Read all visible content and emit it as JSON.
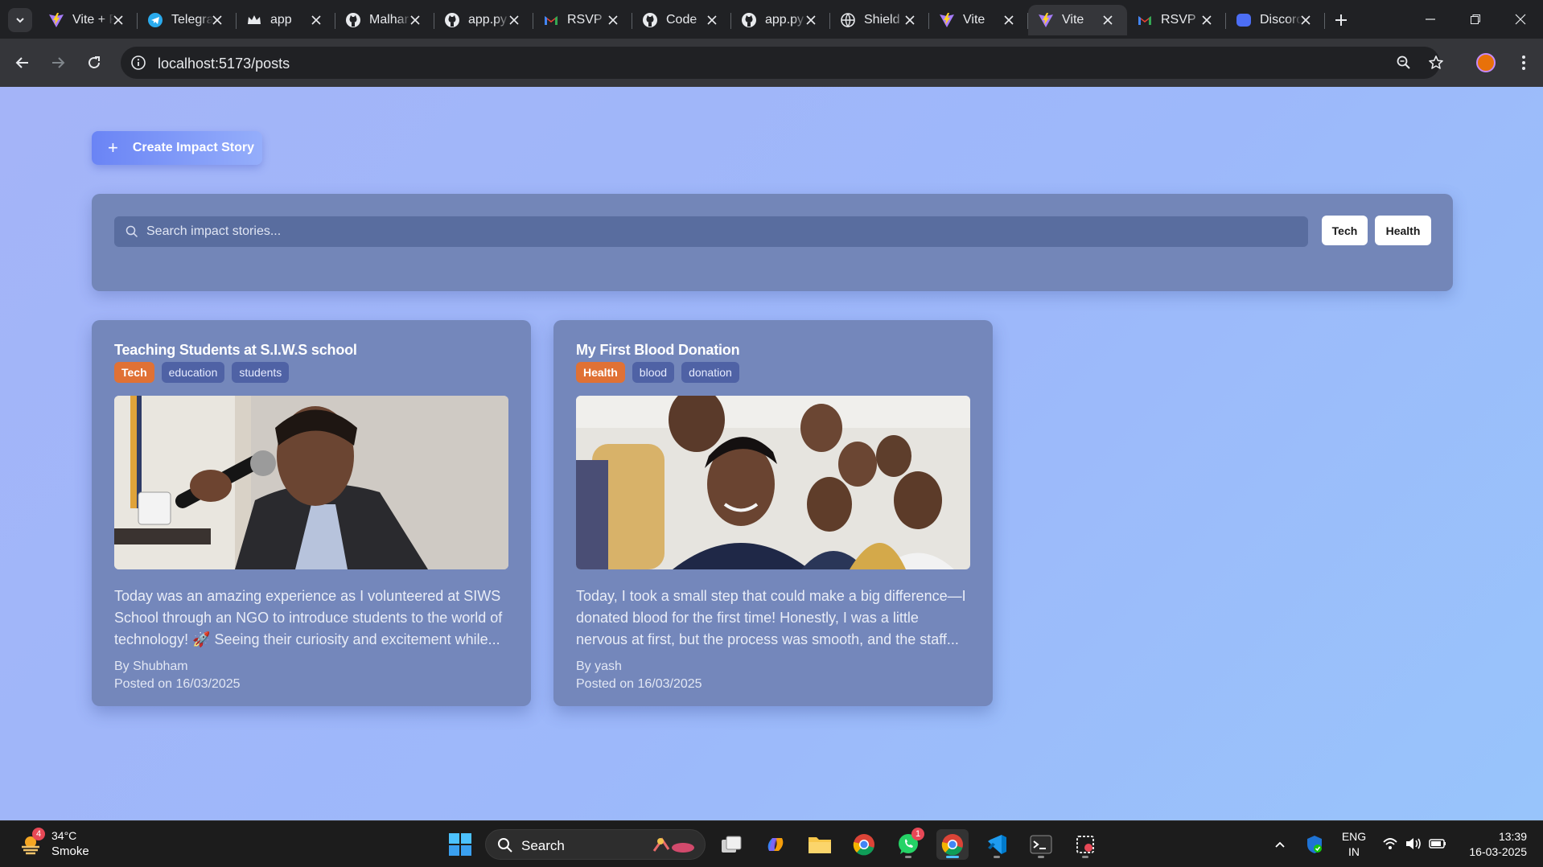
{
  "browser": {
    "tabs": [
      {
        "label": "Vite + React",
        "icon": "vite-icon"
      },
      {
        "label": "Telegram",
        "icon": "telegram-icon"
      },
      {
        "label": "app",
        "icon": "crown-icon"
      },
      {
        "label": "Malhar",
        "icon": "github-icon"
      },
      {
        "label": "app.py",
        "icon": "github-icon"
      },
      {
        "label": "RSVP",
        "icon": "gmail-icon"
      },
      {
        "label": "Code",
        "icon": "github-icon"
      },
      {
        "label": "app.py",
        "icon": "github-icon"
      },
      {
        "label": "Shield",
        "icon": "globe-icon"
      },
      {
        "label": "Vite",
        "icon": "vite-icon"
      },
      {
        "label": "Vite",
        "icon": "vite-icon",
        "active": true
      },
      {
        "label": "RSVP",
        "icon": "gmail-icon"
      },
      {
        "label": "Discord",
        "icon": "discord-icon"
      }
    ],
    "url": "localhost:5173/posts"
  },
  "page": {
    "create_button": "Create Impact Story",
    "search_placeholder": "Search impact stories...",
    "filters": [
      "Tech",
      "Health"
    ],
    "posts": [
      {
        "title": "Teaching Students at S.I.W.S school",
        "category": "Tech",
        "tags": [
          "education",
          "students"
        ],
        "excerpt": "Today was an amazing experience as I volunteered at SIWS School through an NGO to introduce students to the world of technology! 🚀 Seeing their curiosity and excitement while...",
        "author": "By Shubham",
        "date": "Posted on 16/03/2025"
      },
      {
        "title": "My First Blood Donation",
        "category": "Health",
        "tags": [
          "blood",
          "donation"
        ],
        "excerpt": "Today, I took a small step that could make a big difference—I donated blood for the first time! Honestly, I was a little nervous at first, but the process was smooth, and the staff...",
        "author": "By yash",
        "date": "Posted on 16/03/2025"
      }
    ]
  },
  "taskbar": {
    "weather": {
      "temp": "34°C",
      "condition": "Smoke",
      "badge": "4"
    },
    "search_label": "Search",
    "whatsapp_badge": "1",
    "language": "ENG",
    "region": "IN",
    "time": "13:39",
    "date": "16-03-2025"
  }
}
